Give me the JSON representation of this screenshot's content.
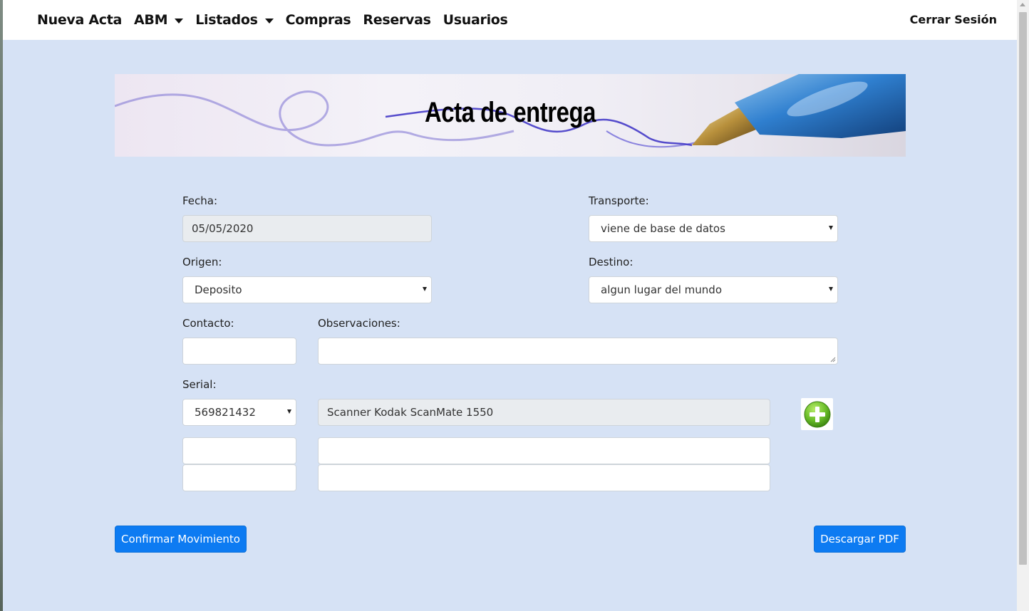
{
  "nav": {
    "items": [
      {
        "label": "Nueva Acta",
        "dropdown": false
      },
      {
        "label": "ABM",
        "dropdown": true
      },
      {
        "label": "Listados",
        "dropdown": true
      },
      {
        "label": "Compras",
        "dropdown": false
      },
      {
        "label": "Reservas",
        "dropdown": false
      },
      {
        "label": "Usuarios",
        "dropdown": false
      }
    ],
    "logout": "Cerrar Sesión"
  },
  "banner": {
    "title": "Acta de entrega"
  },
  "form": {
    "fecha": {
      "label": "Fecha:",
      "value": "05/05/2020"
    },
    "transporte": {
      "label": "Transporte:",
      "value": "viene de base de datos"
    },
    "origen": {
      "label": "Origen:",
      "value": "Deposito"
    },
    "destino": {
      "label": "Destino:",
      "value": "algun lugar del mundo"
    },
    "contacto": {
      "label": "Contacto:",
      "value": ""
    },
    "observaciones": {
      "label": "Observaciones:",
      "value": ""
    },
    "serial": {
      "label": "Serial:",
      "rows": [
        {
          "serial": "569821432",
          "description": "Scanner Kodak ScanMate 1550"
        },
        {
          "serial": "",
          "description": ""
        },
        {
          "serial": "",
          "description": ""
        }
      ]
    }
  },
  "buttons": {
    "confirm": "Confirmar Movimiento",
    "pdf": "Descargar PDF"
  },
  "colors": {
    "page_bg": "#d6e2f5",
    "primary": "#0d7bf2",
    "add_icon": "#6cbf2a"
  },
  "icons": {
    "add": "plus-circle-icon"
  }
}
